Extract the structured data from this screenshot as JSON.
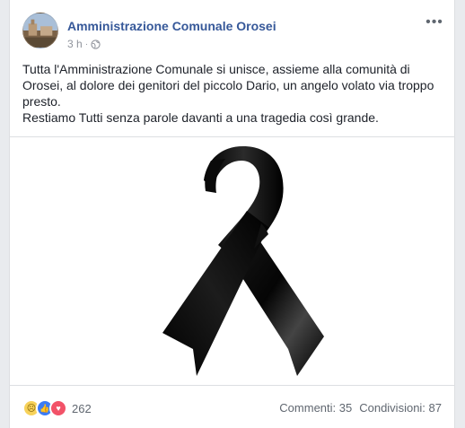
{
  "post": {
    "author": "Amministrazione Comunale Orosei",
    "time": "3 h",
    "privacy_icon": "globe-icon",
    "more_icon": "more-options-icon",
    "paragraphs": [
      "Tutta l'Amministrazione Comunale si unisce, assieme alla comunità di Orosei, al dolore dei genitori del piccolo Dario, un angelo volato via troppo presto.",
      "Restiamo Tutti senza parole davanti a una tragedia così grande."
    ],
    "image": "black-mourning-ribbon"
  },
  "footer": {
    "reaction_icons": [
      "sad-reaction-icon",
      "like-reaction-icon",
      "love-reaction-icon"
    ],
    "reaction_count": "262",
    "comments": "Commenti: 35",
    "shares": "Condivisioni: 87"
  },
  "colors": {
    "author_link": "#365899",
    "meta": "#90949c",
    "background": "#e9ebee"
  }
}
